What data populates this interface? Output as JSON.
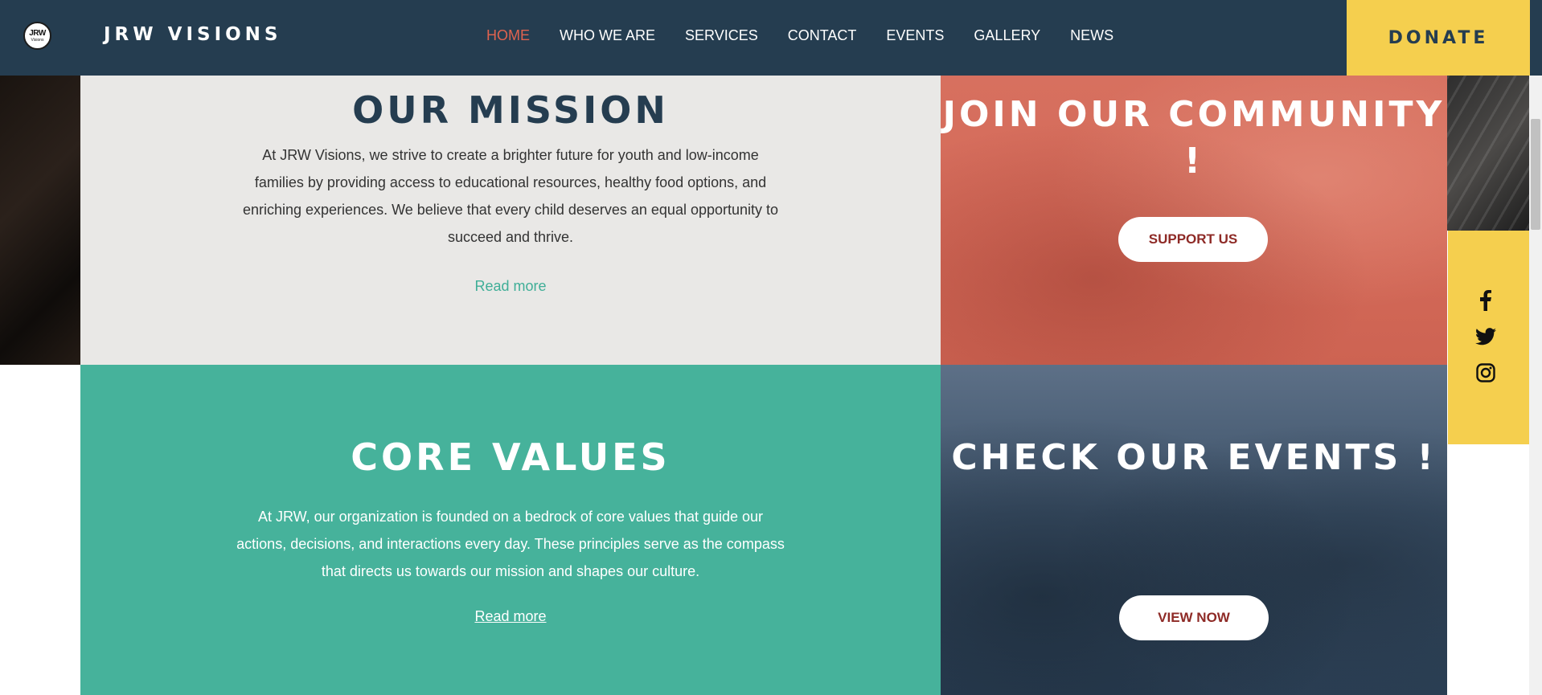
{
  "header": {
    "logo_text": "JRW",
    "logo_subtext": "Visions",
    "brand": "JRW VISIONS",
    "nav": [
      {
        "label": "HOME"
      },
      {
        "label": "WHO WE ARE"
      },
      {
        "label": "SERVICES"
      },
      {
        "label": "CONTACT"
      },
      {
        "label": "EVENTS"
      },
      {
        "label": "GALLERY"
      },
      {
        "label": "NEWS"
      }
    ],
    "donate_label": "DONATE"
  },
  "mission": {
    "title": "OUR MISSION",
    "body": "At JRW Visions, we strive to create a brighter future for youth and low-income families by providing access to educational resources, healthy food options, and enriching experiences. We believe that every child deserves an equal opportunity to succeed and thrive.",
    "read_more": "Read more"
  },
  "core_values": {
    "title": "CORE VALUES",
    "body": "At JRW, our organization is founded on a bedrock of core values that guide our actions, decisions, and interactions every day. These principles serve as the compass that directs us towards our mission and shapes our culture.",
    "read_more": "Read more"
  },
  "join": {
    "title": "JOIN OUR COMMUNITY !",
    "button": "SUPPORT US"
  },
  "events": {
    "title": "CHECK OUR EVENTS !",
    "button": "VIEW NOW"
  },
  "social": [
    "facebook-icon",
    "twitter-icon",
    "instagram-icon"
  ],
  "colors": {
    "header_bg": "#253d50",
    "accent_red": "#e0634f",
    "donate_yellow": "#f5cf4e",
    "teal": "#46b29b",
    "light_gray": "#e9e8e6",
    "button_text": "#8e2a26"
  }
}
